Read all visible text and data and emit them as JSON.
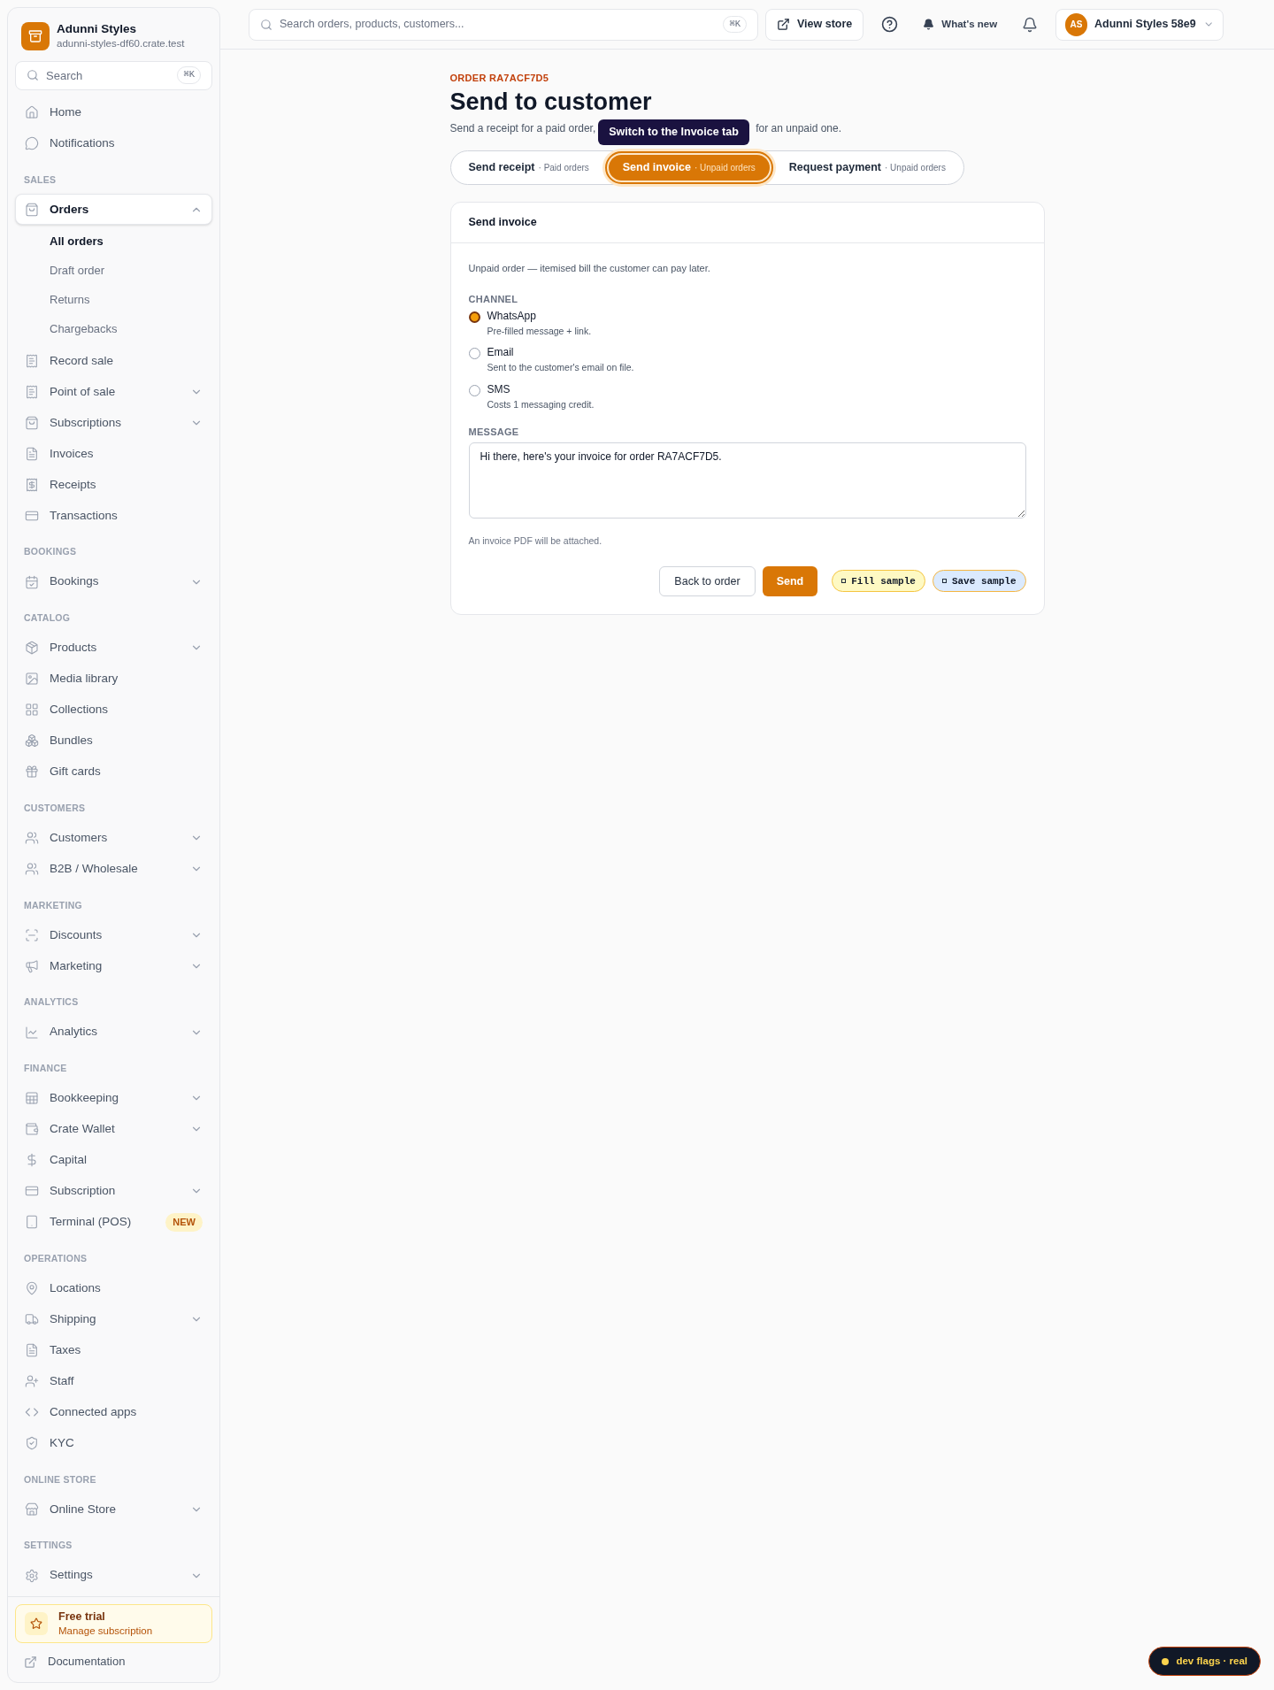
{
  "store": {
    "name": "Adunni Styles",
    "domain": "adunni-styles-df60.crate.test"
  },
  "sidebar_search": {
    "placeholder": "Search",
    "shortcut": "⌘K"
  },
  "nav_sections": [
    {
      "items": [
        {
          "label": "Home",
          "selected": false
        },
        {
          "label": "Notifications",
          "selected": false
        }
      ]
    },
    {
      "title": "SALES",
      "items": [
        {
          "label": "Orders",
          "selected": true,
          "expanded": true,
          "children": [
            {
              "label": "All orders",
              "selected": true
            },
            {
              "label": "Draft order",
              "selected": false
            },
            {
              "label": "Returns",
              "selected": false
            },
            {
              "label": "Chargebacks",
              "selected": false
            }
          ]
        },
        {
          "label": "Record sale",
          "selected": false
        },
        {
          "label": "Point of sale",
          "selected": false,
          "expanded": false
        },
        {
          "label": "Subscriptions",
          "selected": false,
          "expanded": false
        },
        {
          "label": "Invoices",
          "selected": false
        },
        {
          "label": "Receipts",
          "selected": false
        },
        {
          "label": "Transactions",
          "selected": false
        }
      ]
    },
    {
      "title": "BOOKINGS",
      "items": [
        {
          "label": "Bookings",
          "selected": false,
          "expanded": false
        }
      ]
    },
    {
      "title": "CATALOG",
      "items": [
        {
          "label": "Products",
          "selected": false,
          "expanded": false
        },
        {
          "label": "Media library",
          "selected": false
        },
        {
          "label": "Collections",
          "selected": false
        },
        {
          "label": "Bundles",
          "selected": false
        },
        {
          "label": "Gift cards",
          "selected": false
        }
      ]
    },
    {
      "title": "CUSTOMERS",
      "items": [
        {
          "label": "Customers",
          "selected": false,
          "expanded": false
        },
        {
          "label": "B2B / Wholesale",
          "selected": false,
          "expanded": false
        }
      ]
    },
    {
      "title": "MARKETING",
      "items": [
        {
          "label": "Discounts",
          "selected": false,
          "expanded": false
        },
        {
          "label": "Marketing",
          "selected": false,
          "expanded": false
        }
      ]
    },
    {
      "title": "ANALYTICS",
      "items": [
        {
          "label": "Analytics",
          "selected": false,
          "expanded": false
        }
      ]
    },
    {
      "title": "FINANCE",
      "items": [
        {
          "label": "Bookkeeping",
          "selected": false,
          "expanded": false
        },
        {
          "label": "Crate Wallet",
          "selected": false,
          "expanded": false
        },
        {
          "label": "Capital",
          "selected": false
        },
        {
          "label": "Subscription",
          "selected": false,
          "expanded": false
        },
        {
          "label": "Terminal (POS)",
          "selected": false,
          "badge": "NEW"
        }
      ]
    },
    {
      "title": "OPERATIONS",
      "items": [
        {
          "label": "Locations",
          "selected": false
        },
        {
          "label": "Shipping",
          "selected": false,
          "expanded": false
        },
        {
          "label": "Taxes",
          "selected": false
        },
        {
          "label": "Staff",
          "selected": false
        },
        {
          "label": "Connected apps",
          "selected": false
        },
        {
          "label": "KYC",
          "selected": false
        }
      ]
    },
    {
      "title": "ONLINE STORE",
      "items": [
        {
          "label": "Online Store",
          "selected": false,
          "expanded": false
        }
      ]
    },
    {
      "title": "SETTINGS",
      "items": [
        {
          "label": "Settings",
          "selected": false,
          "expanded": false
        }
      ]
    }
  ],
  "trial": {
    "title": "Free trial",
    "link": "Manage subscription"
  },
  "documentation": "Documentation",
  "topbar": {
    "search": {
      "placeholder": "Search orders, products, customers...",
      "shortcut": "⌘K"
    },
    "view_store": "View store",
    "whats_new": "What's new",
    "account": {
      "initials": "AS",
      "name": "Adunni Styles 58e9"
    }
  },
  "page": {
    "eyebrow": "ORDER RA7ACF7D5",
    "title": "Send to customer",
    "subtitle_start": "Send a receipt for a paid order,",
    "subtitle_end": "for an unpaid one."
  },
  "tooltip": "Switch to the Invoice tab",
  "tabs": [
    {
      "label": "Send receipt",
      "hint": "· Paid orders",
      "selected": false
    },
    {
      "label": "Send invoice",
      "hint": "· Unpaid orders",
      "selected": true
    },
    {
      "label": "Request payment",
      "hint": "· Unpaid orders",
      "selected": false
    }
  ],
  "card": {
    "title": "Send invoice",
    "description": "Unpaid order — itemised bill the customer can pay later.",
    "channel_label": "CHANNEL",
    "channels": [
      {
        "label": "WhatsApp",
        "hint": "Pre-filled message + link.",
        "selected": true
      },
      {
        "label": "Email",
        "hint": "Sent to the customer's email on file.",
        "selected": false
      },
      {
        "label": "SMS",
        "hint": "Costs 1 messaging credit.",
        "selected": false
      }
    ],
    "message_label": "MESSAGE",
    "message": "Hi there, here's your invoice for order RA7ACF7D5.",
    "note": "An invoice PDF will be attached.",
    "buttons": [
      {
        "label": "Back to order",
        "kind": "secondary"
      },
      {
        "label": "Send",
        "kind": "primary"
      },
      {
        "label": "Fill sample",
        "kind": "sample-yellow"
      },
      {
        "label": "Save sample",
        "kind": "sample-blue"
      }
    ]
  },
  "dev_flags": "dev flags · real"
}
